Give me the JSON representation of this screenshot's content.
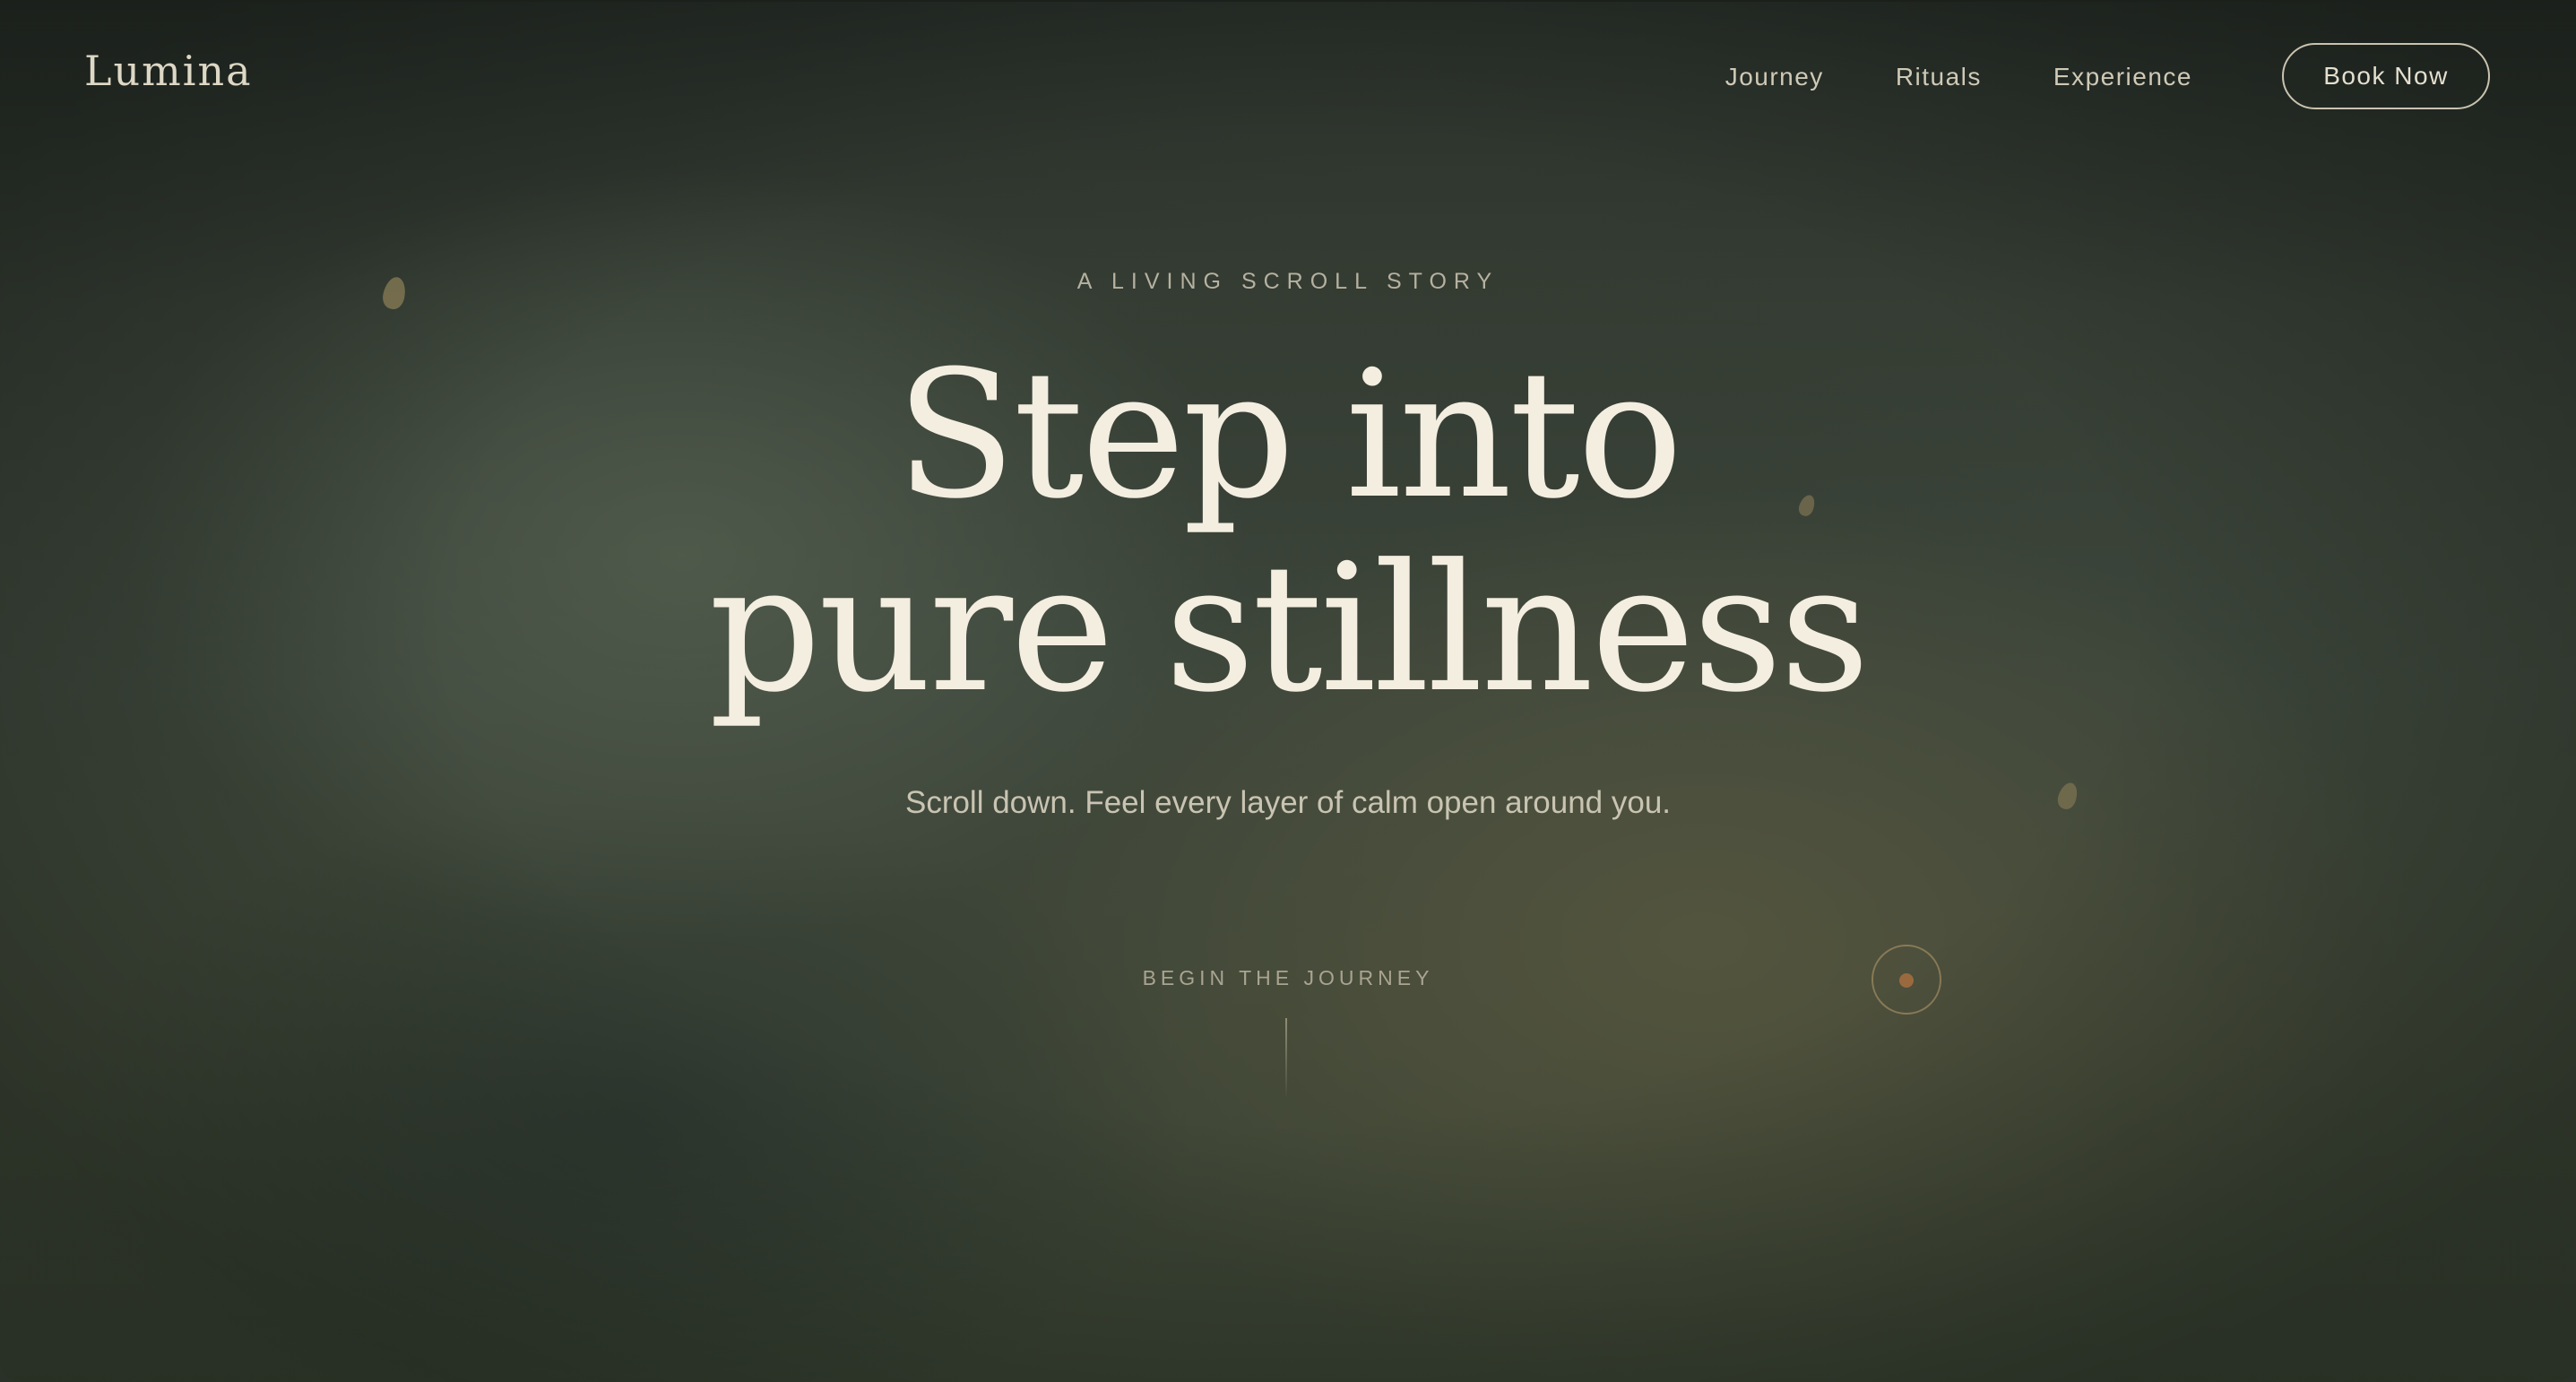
{
  "nav": {
    "logo": "Lumina",
    "links": [
      {
        "label": "Journey"
      },
      {
        "label": "Rituals"
      },
      {
        "label": "Experience"
      }
    ],
    "cta_label": "Book Now"
  },
  "hero": {
    "eyebrow": "A LIVING SCROLL STORY",
    "headline_line1": "Step into",
    "headline_line2": "pure stillness",
    "subtitle": "Scroll down. Feel every layer of calm open around you.",
    "scroll_cta": "BEGIN THE JOURNEY"
  },
  "colors": {
    "background": "#3d463b",
    "headline": "#f3eee0",
    "muted_text": "#b6b1a0",
    "accent": "#9a6a3e"
  }
}
